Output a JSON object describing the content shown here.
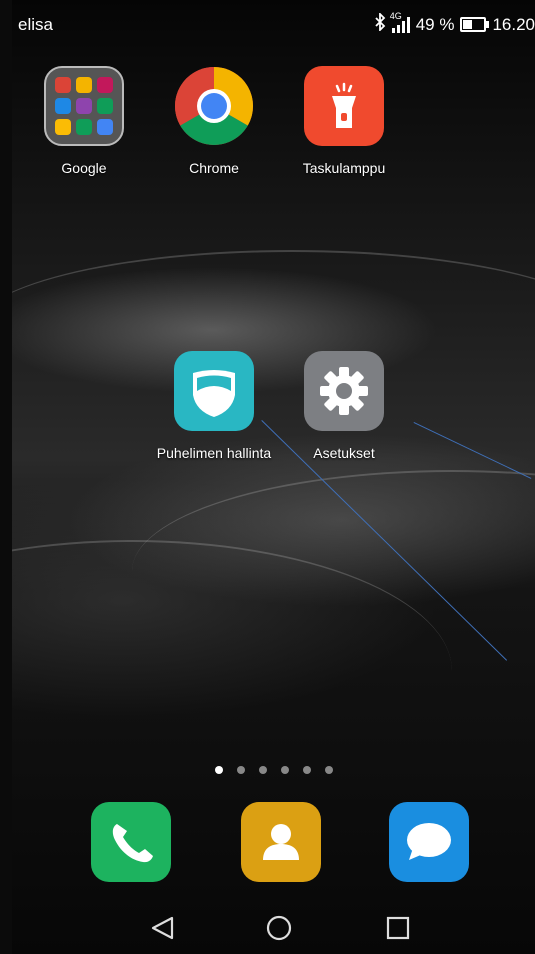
{
  "status_bar": {
    "carrier": "elisa",
    "network_type": "4G",
    "battery_level": "49 %",
    "battery_fraction": 0.49,
    "time": "16.20"
  },
  "home": {
    "apps_row1": [
      {
        "label": "Google",
        "icon": "google-folder-icon"
      },
      {
        "label": "Chrome",
        "icon": "chrome-icon"
      },
      {
        "label": "Taskulamppu",
        "icon": "flashlight-icon"
      }
    ],
    "apps_row2": [
      {
        "label": "Puhelimen hallinta",
        "icon": "phone-manager-icon"
      },
      {
        "label": "Asetukset",
        "icon": "settings-gear-icon"
      }
    ]
  },
  "page_indicator": {
    "pages": 6,
    "active": 0
  },
  "dock": [
    {
      "name": "phone",
      "icon": "phone-icon",
      "color": "#1db35f"
    },
    {
      "name": "contacts",
      "icon": "contacts-icon",
      "color": "#dba013"
    },
    {
      "name": "messages",
      "icon": "messages-icon",
      "color": "#1a8ee0"
    }
  ],
  "navigation": [
    "back-icon",
    "home-icon",
    "recents-icon"
  ],
  "colors": {
    "chrome_red": "#db4437",
    "chrome_yellow": "#f4b400",
    "chrome_green": "#0f9d58",
    "chrome_blue": "#4285f4",
    "flashlight": "#f04a2e",
    "phone_manager": "#29b7c3",
    "settings": "#7d7f83",
    "annotation_line": "#3f6fb7"
  }
}
